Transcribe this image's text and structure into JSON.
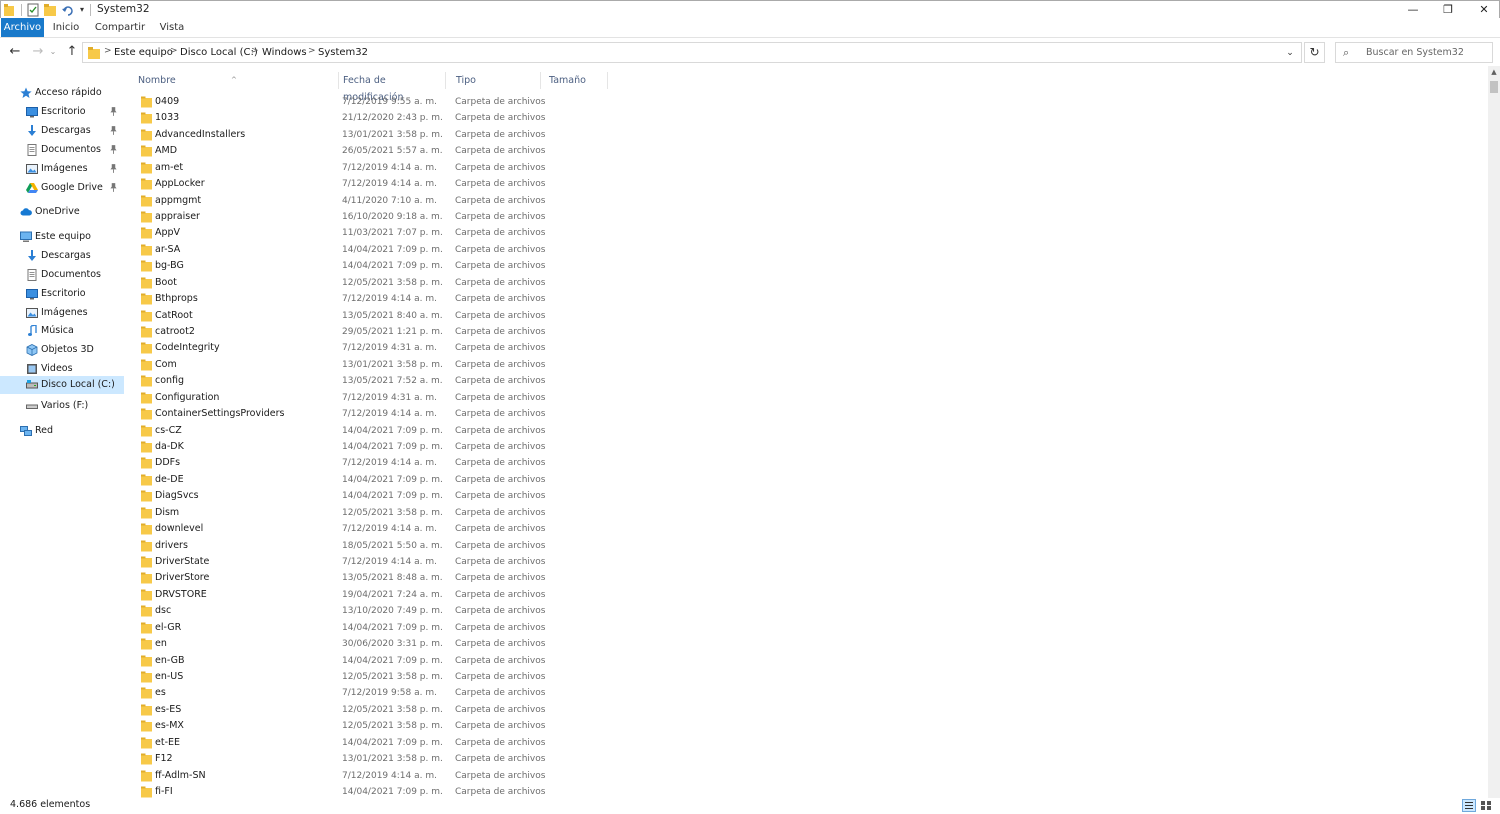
{
  "window": {
    "title": "System32",
    "minimize": "—",
    "maximize": "❐",
    "close": "✕",
    "customize_qa": "▾"
  },
  "ribbon": {
    "tabs": [
      "Archivo",
      "Inicio",
      "Compartir",
      "Vista"
    ],
    "active_tab": "Archivo"
  },
  "nav": {
    "back": "←",
    "forward": "→",
    "recent": "⌄",
    "up": "↑",
    "refresh": "↻",
    "address_dropdown": "⌄"
  },
  "breadcrumb": [
    "Este equipo",
    "Disco Local (C:)",
    "Windows",
    "System32"
  ],
  "breadcrumb_separator": ">",
  "search": {
    "icon": "⌕",
    "placeholder": "Buscar en System32"
  },
  "sidebar": {
    "pin_glyph": "📌",
    "items": [
      {
        "label": "Acceso rápido",
        "icon": "star-icon",
        "level": 0
      },
      {
        "label": "Escritorio",
        "icon": "desktop-icon",
        "level": 1,
        "pinned": true
      },
      {
        "label": "Descargas",
        "icon": "download-icon",
        "level": 1,
        "pinned": true
      },
      {
        "label": "Documentos",
        "icon": "document-icon",
        "level": 1,
        "pinned": true
      },
      {
        "label": "Imágenes",
        "icon": "pictures-icon",
        "level": 1,
        "pinned": true
      },
      {
        "label": "Google Drive",
        "icon": "google-drive-icon",
        "level": 1,
        "pinned": true
      },
      {
        "label": "OneDrive",
        "icon": "cloud-icon",
        "level": 0
      },
      {
        "label": "Este equipo",
        "icon": "computer-icon",
        "level": 0
      },
      {
        "label": "Descargas",
        "icon": "download-icon",
        "level": 1
      },
      {
        "label": "Documentos",
        "icon": "document-icon",
        "level": 1
      },
      {
        "label": "Escritorio",
        "icon": "desktop-icon",
        "level": 1
      },
      {
        "label": "Imágenes",
        "icon": "pictures-icon",
        "level": 1
      },
      {
        "label": "Música",
        "icon": "music-icon",
        "level": 1
      },
      {
        "label": "Objetos 3D",
        "icon": "cube-icon",
        "level": 1
      },
      {
        "label": "Videos",
        "icon": "video-icon",
        "level": 1
      },
      {
        "label": "Disco Local (C:)",
        "icon": "drive-icon",
        "level": 1,
        "selected": true
      },
      {
        "label": "Varios (F:)",
        "icon": "usb-drive-icon",
        "level": 1
      },
      {
        "label": "Red",
        "icon": "network-icon",
        "level": 0
      }
    ]
  },
  "columns": {
    "name": "Nombre",
    "date": "Fecha de modificación",
    "type": "Tipo",
    "size": "Tamaño",
    "sort_indicator": "^"
  },
  "colors": {
    "accent": "#1979ca",
    "folder": "#f7c948",
    "selected": "#cce8ff",
    "header_text": "#4d6082"
  },
  "files": [
    {
      "name": "0409",
      "date": "7/12/2019 9:55 a. m.",
      "type": "Carpeta de archivos"
    },
    {
      "name": "1033",
      "date": "21/12/2020 2:43 p. m.",
      "type": "Carpeta de archivos"
    },
    {
      "name": "AdvancedInstallers",
      "date": "13/01/2021 3:58 p. m.",
      "type": "Carpeta de archivos"
    },
    {
      "name": "AMD",
      "date": "26/05/2021 5:57 a. m.",
      "type": "Carpeta de archivos"
    },
    {
      "name": "am-et",
      "date": "7/12/2019 4:14 a. m.",
      "type": "Carpeta de archivos"
    },
    {
      "name": "AppLocker",
      "date": "7/12/2019 4:14 a. m.",
      "type": "Carpeta de archivos"
    },
    {
      "name": "appmgmt",
      "date": "4/11/2020 7:10 a. m.",
      "type": "Carpeta de archivos"
    },
    {
      "name": "appraiser",
      "date": "16/10/2020 9:18 a. m.",
      "type": "Carpeta de archivos"
    },
    {
      "name": "AppV",
      "date": "11/03/2021 7:07 p. m.",
      "type": "Carpeta de archivos"
    },
    {
      "name": "ar-SA",
      "date": "14/04/2021 7:09 p. m.",
      "type": "Carpeta de archivos"
    },
    {
      "name": "bg-BG",
      "date": "14/04/2021 7:09 p. m.",
      "type": "Carpeta de archivos"
    },
    {
      "name": "Boot",
      "date": "12/05/2021 3:58 p. m.",
      "type": "Carpeta de archivos"
    },
    {
      "name": "Bthprops",
      "date": "7/12/2019 4:14 a. m.",
      "type": "Carpeta de archivos"
    },
    {
      "name": "CatRoot",
      "date": "13/05/2021 8:40 a. m.",
      "type": "Carpeta de archivos"
    },
    {
      "name": "catroot2",
      "date": "29/05/2021 1:21 p. m.",
      "type": "Carpeta de archivos"
    },
    {
      "name": "CodeIntegrity",
      "date": "7/12/2019 4:31 a. m.",
      "type": "Carpeta de archivos"
    },
    {
      "name": "Com",
      "date": "13/01/2021 3:58 p. m.",
      "type": "Carpeta de archivos"
    },
    {
      "name": "config",
      "date": "13/05/2021 7:52 a. m.",
      "type": "Carpeta de archivos"
    },
    {
      "name": "Configuration",
      "date": "7/12/2019 4:31 a. m.",
      "type": "Carpeta de archivos"
    },
    {
      "name": "ContainerSettingsProviders",
      "date": "7/12/2019 4:14 a. m.",
      "type": "Carpeta de archivos"
    },
    {
      "name": "cs-CZ",
      "date": "14/04/2021 7:09 p. m.",
      "type": "Carpeta de archivos"
    },
    {
      "name": "da-DK",
      "date": "14/04/2021 7:09 p. m.",
      "type": "Carpeta de archivos"
    },
    {
      "name": "DDFs",
      "date": "7/12/2019 4:14 a. m.",
      "type": "Carpeta de archivos"
    },
    {
      "name": "de-DE",
      "date": "14/04/2021 7:09 p. m.",
      "type": "Carpeta de archivos"
    },
    {
      "name": "DiagSvcs",
      "date": "14/04/2021 7:09 p. m.",
      "type": "Carpeta de archivos"
    },
    {
      "name": "Dism",
      "date": "12/05/2021 3:58 p. m.",
      "type": "Carpeta de archivos"
    },
    {
      "name": "downlevel",
      "date": "7/12/2019 4:14 a. m.",
      "type": "Carpeta de archivos"
    },
    {
      "name": "drivers",
      "date": "18/05/2021 5:50 a. m.",
      "type": "Carpeta de archivos"
    },
    {
      "name": "DriverState",
      "date": "7/12/2019 4:14 a. m.",
      "type": "Carpeta de archivos"
    },
    {
      "name": "DriverStore",
      "date": "13/05/2021 8:48 a. m.",
      "type": "Carpeta de archivos"
    },
    {
      "name": "DRVSTORE",
      "date": "19/04/2021 7:24 a. m.",
      "type": "Carpeta de archivos"
    },
    {
      "name": "dsc",
      "date": "13/10/2020 7:49 p. m.",
      "type": "Carpeta de archivos"
    },
    {
      "name": "el-GR",
      "date": "14/04/2021 7:09 p. m.",
      "type": "Carpeta de archivos"
    },
    {
      "name": "en",
      "date": "30/06/2020 3:31 p. m.",
      "type": "Carpeta de archivos"
    },
    {
      "name": "en-GB",
      "date": "14/04/2021 7:09 p. m.",
      "type": "Carpeta de archivos"
    },
    {
      "name": "en-US",
      "date": "12/05/2021 3:58 p. m.",
      "type": "Carpeta de archivos"
    },
    {
      "name": "es",
      "date": "7/12/2019 9:58 a. m.",
      "type": "Carpeta de archivos"
    },
    {
      "name": "es-ES",
      "date": "12/05/2021 3:58 p. m.",
      "type": "Carpeta de archivos"
    },
    {
      "name": "es-MX",
      "date": "12/05/2021 3:58 p. m.",
      "type": "Carpeta de archivos"
    },
    {
      "name": "et-EE",
      "date": "14/04/2021 7:09 p. m.",
      "type": "Carpeta de archivos"
    },
    {
      "name": "F12",
      "date": "13/01/2021 3:58 p. m.",
      "type": "Carpeta de archivos"
    },
    {
      "name": "ff-Adlm-SN",
      "date": "7/12/2019 4:14 a. m.",
      "type": "Carpeta de archivos"
    },
    {
      "name": "fi-FI",
      "date": "14/04/2021 7:09 p. m.",
      "type": "Carpeta de archivos"
    }
  ],
  "status": {
    "count": "4.686 elementos"
  }
}
